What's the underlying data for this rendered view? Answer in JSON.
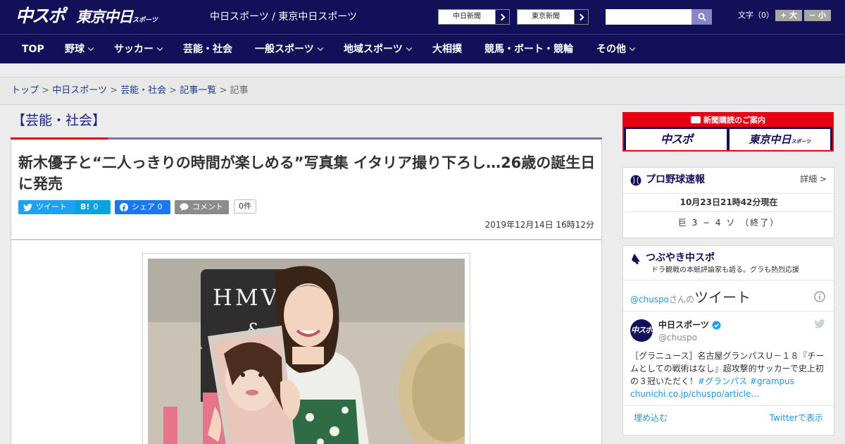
{
  "header": {
    "logo_chuspo": "中スポ",
    "logo_tokyo": "東京中日",
    "logo_tokyo_small": "スポーツ",
    "site_name": "中日スポーツ / 東京中日スポーツ",
    "links": [
      "中日新聞",
      "東京新聞"
    ],
    "search": {
      "value": "",
      "placeholder": ""
    },
    "font_size_label": "文字（0）",
    "font_size_up": "+ 大",
    "font_size_down": "− 小"
  },
  "nav": [
    {
      "label": "TOP",
      "dropdown": false
    },
    {
      "label": "野球",
      "dropdown": true
    },
    {
      "label": "サッカー",
      "dropdown": true
    },
    {
      "label": "芸能・社会",
      "dropdown": false
    },
    {
      "label": "一般スポーツ",
      "dropdown": true
    },
    {
      "label": "地域スポーツ",
      "dropdown": true
    },
    {
      "label": "大相撲",
      "dropdown": false
    },
    {
      "label": "競馬・ボート・競輪",
      "dropdown": false
    },
    {
      "label": "その他",
      "dropdown": true
    }
  ],
  "breadcrumb": {
    "items": [
      "トップ",
      "中日スポーツ",
      "芸能・社会",
      "記事一覧"
    ],
    "current": "記事",
    "separator": ">"
  },
  "article": {
    "category": "【芸能・社会】",
    "title": "新木優子と“二人っきりの時間が楽しめる”写真集 イタリア撮り下ろし…26歳の誕生日に発売",
    "share": {
      "tweet": "ツイート",
      "hatena_label": "B!",
      "hatena_count": "0",
      "facebook": "シェア 0",
      "comment": "コメント",
      "comment_count": "0件"
    },
    "date": "2019年12月14日 16時12分",
    "photo_sign_text": "HMV & B"
  },
  "sidebar": {
    "subscription": {
      "title": "新聞購読のご案内",
      "brands": [
        "中スポ",
        "東京中日"
      ],
      "brand_small": "スポーツ"
    },
    "baseball": {
      "title": "プロ野球速報",
      "detail": "詳細 >",
      "time": "10月23日21時42分現在",
      "score": "巨 3 − 4 ソ （終了）"
    },
    "twitter": {
      "title": "つぶやき中スポ",
      "subtitle": "ドラ観戦の本紙評論家も語る。グラも熱烈応援",
      "timeline_handle": "@chuspo",
      "timeline_mid": "さんの",
      "timeline_word": "ツイート",
      "avatar_text": "中スポ",
      "name": "中日スポーツ",
      "handle": "@chuspo",
      "tweet_text": "［グラニュース］名古屋グランパスＵ－１８『チームとしての戦術はなし』超攻撃的サッカーで史上初の３冠いただく！",
      "tweet_tag": "#グランパス #grampus",
      "tweet_link": "chunichi.co.jp/chuspo/article…",
      "embed": "埋め込む",
      "show_on_twitter": "Twitterで表示"
    }
  },
  "colors": {
    "brand_navy": "#13105a",
    "accent_red": "#e60012",
    "twitter_blue": "#1da1f2",
    "facebook_blue": "#1877f2",
    "hatena_blue": "#00a4de"
  }
}
